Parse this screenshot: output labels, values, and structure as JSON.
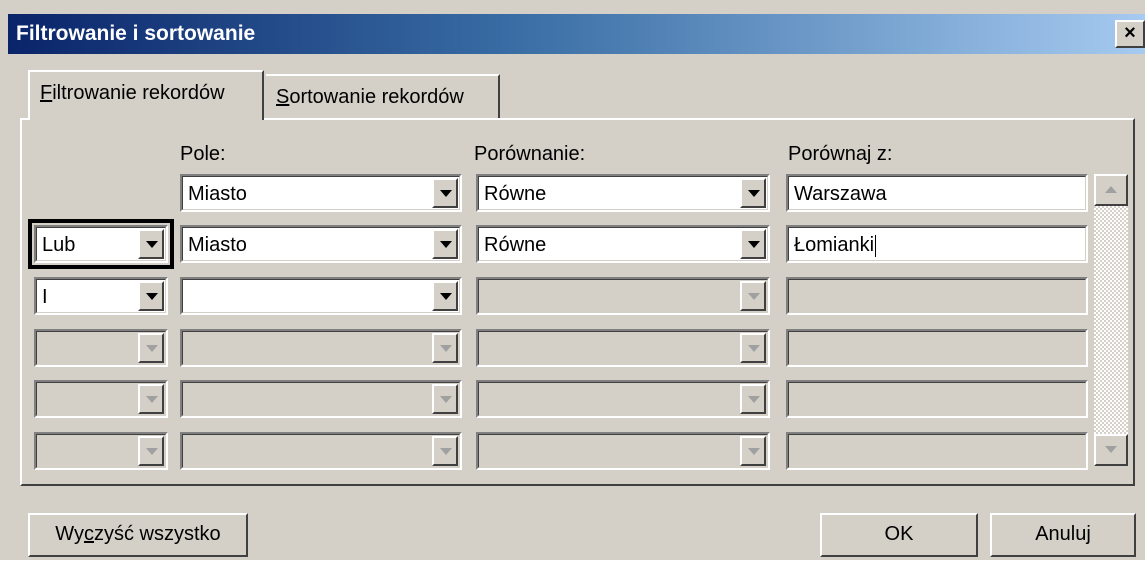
{
  "window": {
    "title": "Filtrowanie i sortowanie",
    "close_label": "×"
  },
  "tabs": [
    {
      "label_pre": "",
      "label_key": "F",
      "label_rest": "iltrowanie rekordów",
      "active": true
    },
    {
      "label_pre": "",
      "label_key": "S",
      "label_rest": "ortowanie rekordów",
      "active": false
    }
  ],
  "columns": {
    "field": "Pole:",
    "comparison": "Porównanie:",
    "compare_to": "Porównaj z:"
  },
  "rows": [
    {
      "conj": null,
      "field": "Miasto",
      "comparison": "Równe",
      "compare_to": "Warszawa"
    },
    {
      "conj": "Lub",
      "field": "Miasto",
      "comparison": "Równe",
      "compare_to": "Łomianki"
    },
    {
      "conj": "I",
      "field": "",
      "comparison": "",
      "compare_to": ""
    },
    {
      "conj": "",
      "field": "",
      "comparison": "",
      "compare_to": ""
    },
    {
      "conj": "",
      "field": "",
      "comparison": "",
      "compare_to": ""
    },
    {
      "conj": "",
      "field": "",
      "comparison": "",
      "compare_to": ""
    }
  ],
  "buttons": {
    "clear_pre": "Wy",
    "clear_key": "c",
    "clear_rest": "zyść wszystko",
    "ok": "OK",
    "cancel": "Anuluj"
  }
}
